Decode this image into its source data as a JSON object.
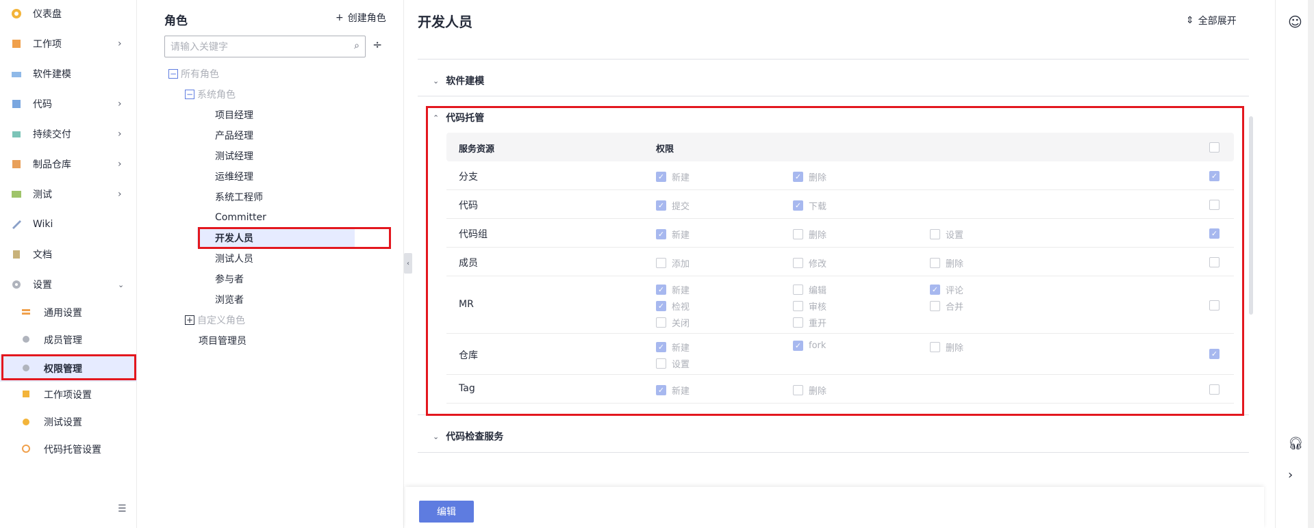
{
  "nav": {
    "items": [
      {
        "label": "仪表盘",
        "icon": "dashboard-icon",
        "chevron": false
      },
      {
        "label": "工作项",
        "icon": "workitem-icon",
        "chevron": true
      },
      {
        "label": "软件建模",
        "icon": "modeling-icon",
        "chevron": false
      },
      {
        "label": "代码",
        "icon": "code-icon",
        "chevron": true
      },
      {
        "label": "持续交付",
        "icon": "delivery-icon",
        "chevron": true
      },
      {
        "label": "制品仓库",
        "icon": "artifact-icon",
        "chevron": true
      },
      {
        "label": "测试",
        "icon": "test-icon",
        "chevron": true
      },
      {
        "label": "Wiki",
        "icon": "wiki-icon",
        "chevron": false
      },
      {
        "label": "文档",
        "icon": "doc-icon",
        "chevron": false
      },
      {
        "label": "设置",
        "icon": "settings-icon",
        "chevron": true
      }
    ],
    "sub_items": [
      {
        "label": "通用设置",
        "icon": "general-settings-icon"
      },
      {
        "label": "成员管理",
        "icon": "member-icon"
      },
      {
        "label": "权限管理",
        "icon": "permission-icon"
      },
      {
        "label": "工作项设置",
        "icon": "workitem-settings-icon"
      },
      {
        "label": "测试设置",
        "icon": "test-settings-icon"
      },
      {
        "label": "代码托管设置",
        "icon": "repo-settings-icon"
      }
    ]
  },
  "roles": {
    "title": "角色",
    "create_label": "创建角色",
    "search_placeholder": "请输入关键字",
    "tree": {
      "all": "所有角色",
      "system": "系统角色",
      "system_roles": [
        "项目经理",
        "产品经理",
        "测试经理",
        "运维经理",
        "系统工程师",
        "Committer",
        "开发人员",
        "测试人员",
        "参与者",
        "浏览者"
      ],
      "custom": "自定义角色",
      "custom_roles": [
        "项目管理员"
      ]
    }
  },
  "main": {
    "title": "开发人员",
    "expand_all": "全部展开",
    "sections": {
      "modeling": "软件建模",
      "repo": "代码托管",
      "check": "代码检查服务"
    },
    "table": {
      "col_resource": "服务资源",
      "col_permission": "权限",
      "rows": [
        {
          "resource": "分支",
          "perms": [
            {
              "label": "新建",
              "checked": true
            },
            {
              "label": "删除",
              "checked": true
            }
          ],
          "row_checked": true
        },
        {
          "resource": "代码",
          "perms": [
            {
              "label": "提交",
              "checked": true
            },
            {
              "label": "下载",
              "checked": true
            }
          ],
          "row_checked": false
        },
        {
          "resource": "代码组",
          "perms": [
            {
              "label": "新建",
              "checked": true
            },
            {
              "label": "删除",
              "checked": false
            },
            {
              "label": "设置",
              "checked": false
            }
          ],
          "row_checked": true
        },
        {
          "resource": "成员",
          "perms": [
            {
              "label": "添加",
              "checked": false
            },
            {
              "label": "修改",
              "checked": false
            },
            {
              "label": "删除",
              "checked": false
            }
          ],
          "row_checked": false
        },
        {
          "resource": "MR",
          "perms": [
            {
              "label": "新建",
              "checked": true
            },
            {
              "label": "编辑",
              "checked": false
            },
            {
              "label": "评论",
              "checked": true
            },
            {
              "label": "检视",
              "checked": true
            },
            {
              "label": "审核",
              "checked": false
            },
            {
              "label": "合并",
              "checked": false
            },
            {
              "label": "关闭",
              "checked": false
            },
            {
              "label": "重开",
              "checked": false
            }
          ],
          "row_checked": false
        },
        {
          "resource": "仓库",
          "perms": [
            {
              "label": "新建",
              "checked": true
            },
            {
              "label": "fork",
              "checked": true
            },
            {
              "label": "删除",
              "checked": false
            },
            {
              "label": "设置",
              "checked": false
            }
          ],
          "row_checked": true
        },
        {
          "resource": "Tag",
          "perms": [
            {
              "label": "新建",
              "checked": true
            },
            {
              "label": "删除",
              "checked": false
            }
          ],
          "row_checked": false
        }
      ]
    },
    "edit_label": "编辑"
  },
  "colors": {
    "accent": "#5e7ce0",
    "highlight": "#e3171e",
    "selected_bg": "#e6ebff"
  }
}
